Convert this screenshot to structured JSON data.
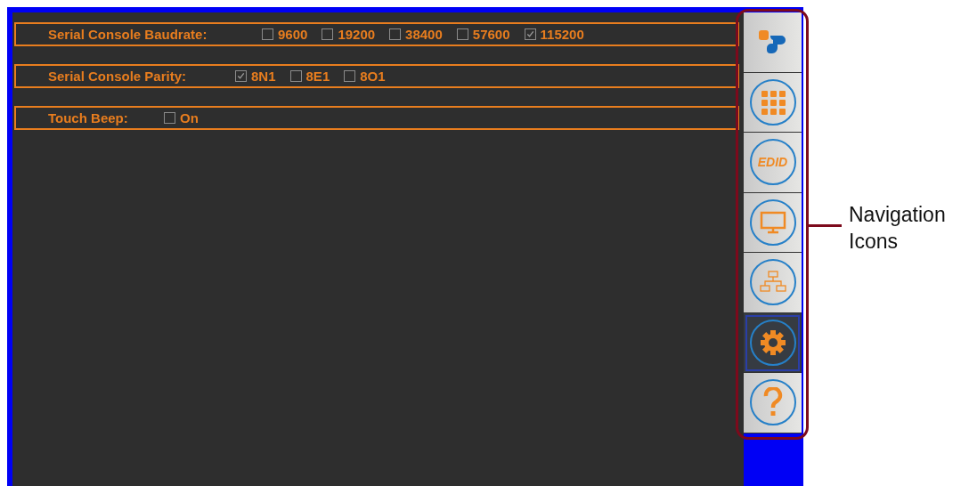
{
  "settings": [
    {
      "label": "Serial Console Baudrate:",
      "options": [
        {
          "label": "9600",
          "checked": false
        },
        {
          "label": "19200",
          "checked": false
        },
        {
          "label": "38400",
          "checked": false
        },
        {
          "label": "57600",
          "checked": false
        },
        {
          "label": "115200",
          "checked": true
        }
      ]
    },
    {
      "label": "Serial Console Parity:",
      "options": [
        {
          "label": "8N1",
          "checked": true
        },
        {
          "label": "8E1",
          "checked": false
        },
        {
          "label": "8O1",
          "checked": false
        }
      ]
    },
    {
      "label": "Touch Beep:",
      "options": [
        {
          "label": "On",
          "checked": false
        }
      ]
    }
  ],
  "navigation": [
    {
      "kind": "logo",
      "selected": false
    },
    {
      "kind": "apps",
      "selected": false
    },
    {
      "kind": "edid",
      "label": "EDID",
      "selected": false
    },
    {
      "kind": "display",
      "selected": false
    },
    {
      "kind": "network",
      "selected": false
    },
    {
      "kind": "settings",
      "selected": true
    },
    {
      "kind": "help",
      "selected": false
    }
  ],
  "callout": "Navigation Icons"
}
